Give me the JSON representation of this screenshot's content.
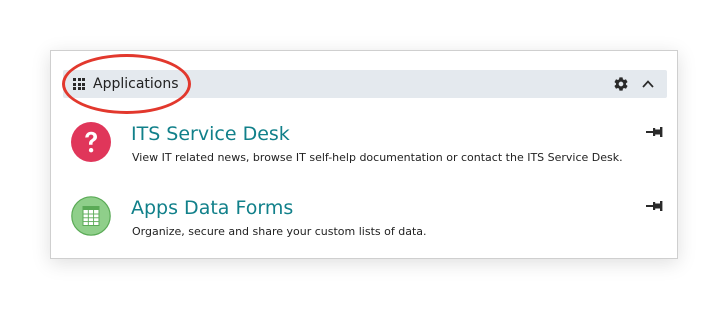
{
  "header": {
    "title": "Applications",
    "icon": "grid-icon",
    "actions": [
      "gear-icon",
      "chevron-up-icon"
    ]
  },
  "apps": [
    {
      "title": "ITS Service Desk",
      "description": "View IT related news, browse IT self-help documentation or contact the ITS Service Desk.",
      "icon": "question-icon",
      "icon_color": "#e0365a",
      "action_icon": "pin-icon"
    },
    {
      "title": "Apps Data Forms",
      "description": "Organize, secure and share your custom lists of data.",
      "icon": "spreadsheet-icon",
      "icon_color": "#8fcf8a",
      "action_icon": "pin-icon"
    }
  ],
  "colors": {
    "accent": "#11808a",
    "highlight_ring": "#e2382d",
    "header_bg": "#e4e9ee"
  }
}
